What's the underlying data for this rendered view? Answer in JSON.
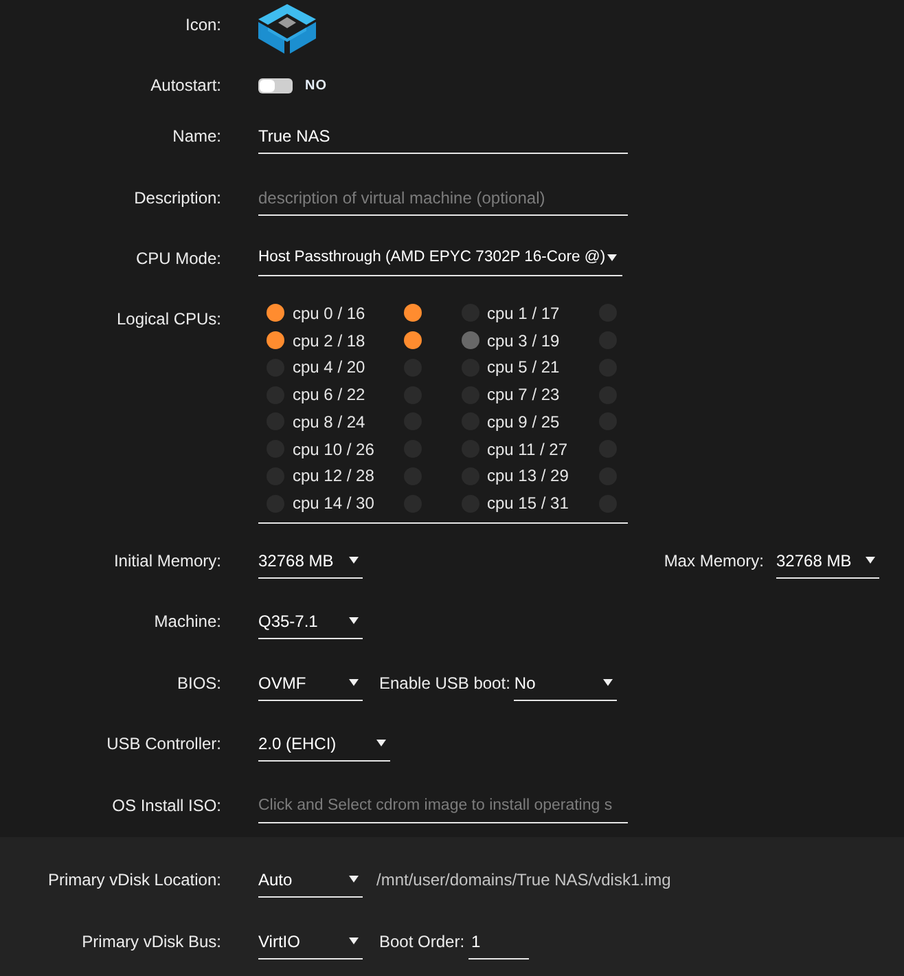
{
  "icon": {
    "label": "Icon:"
  },
  "autostart": {
    "label": "Autostart:",
    "on": false,
    "state_text": "NO"
  },
  "name": {
    "label": "Name:",
    "value": "True NAS"
  },
  "description": {
    "label": "Description:",
    "placeholder": "description of virtual machine (optional)"
  },
  "cpu_mode": {
    "label": "CPU Mode:",
    "value": "Host Passthrough (AMD EPYC 7302P 16-Core @)"
  },
  "logical_cpus": {
    "label": "Logical CPUs:",
    "pairs": [
      {
        "label": "cpu 0 / 16",
        "threads": [
          {
            "checked": true,
            "hovered": false
          },
          {
            "checked": true,
            "hovered": false
          }
        ]
      },
      {
        "label": "cpu 1 / 17",
        "threads": [
          {
            "checked": false,
            "hovered": false
          },
          {
            "checked": false,
            "hovered": false
          }
        ]
      },
      {
        "label": "cpu 2 / 18",
        "threads": [
          {
            "checked": true,
            "hovered": false
          },
          {
            "checked": true,
            "hovered": false
          }
        ]
      },
      {
        "label": "cpu 3 / 19",
        "threads": [
          {
            "checked": false,
            "hovered": true
          },
          {
            "checked": false,
            "hovered": false
          }
        ]
      },
      {
        "label": "cpu 4 / 20",
        "threads": [
          {
            "checked": false,
            "hovered": false
          },
          {
            "checked": false,
            "hovered": false
          }
        ]
      },
      {
        "label": "cpu 5 / 21",
        "threads": [
          {
            "checked": false,
            "hovered": false
          },
          {
            "checked": false,
            "hovered": false
          }
        ]
      },
      {
        "label": "cpu 6 / 22",
        "threads": [
          {
            "checked": false,
            "hovered": false
          },
          {
            "checked": false,
            "hovered": false
          }
        ]
      },
      {
        "label": "cpu 7 / 23",
        "threads": [
          {
            "checked": false,
            "hovered": false
          },
          {
            "checked": false,
            "hovered": false
          }
        ]
      },
      {
        "label": "cpu 8 / 24",
        "threads": [
          {
            "checked": false,
            "hovered": false
          },
          {
            "checked": false,
            "hovered": false
          }
        ]
      },
      {
        "label": "cpu 9 / 25",
        "threads": [
          {
            "checked": false,
            "hovered": false
          },
          {
            "checked": false,
            "hovered": false
          }
        ]
      },
      {
        "label": "cpu 10 / 26",
        "threads": [
          {
            "checked": false,
            "hovered": false
          },
          {
            "checked": false,
            "hovered": false
          }
        ]
      },
      {
        "label": "cpu 11 / 27",
        "threads": [
          {
            "checked": false,
            "hovered": false
          },
          {
            "checked": false,
            "hovered": false
          }
        ]
      },
      {
        "label": "cpu 12 / 28",
        "threads": [
          {
            "checked": false,
            "hovered": false
          },
          {
            "checked": false,
            "hovered": false
          }
        ]
      },
      {
        "label": "cpu 13 / 29",
        "threads": [
          {
            "checked": false,
            "hovered": false
          },
          {
            "checked": false,
            "hovered": false
          }
        ]
      },
      {
        "label": "cpu 14 / 30",
        "threads": [
          {
            "checked": false,
            "hovered": false
          },
          {
            "checked": false,
            "hovered": false
          }
        ]
      },
      {
        "label": "cpu 15 / 31",
        "threads": [
          {
            "checked": false,
            "hovered": false
          },
          {
            "checked": false,
            "hovered": false
          }
        ]
      }
    ]
  },
  "initial_memory": {
    "label": "Initial Memory:",
    "value": "32768 MB"
  },
  "max_memory": {
    "label": "Max Memory:",
    "value": "32768 MB"
  },
  "machine": {
    "label": "Machine:",
    "value": "Q35-7.1"
  },
  "bios": {
    "label": "BIOS:",
    "value": "OVMF"
  },
  "usb_boot": {
    "label": "Enable USB boot:",
    "value": "No"
  },
  "usb_controller": {
    "label": "USB Controller:",
    "value": "2.0 (EHCI)"
  },
  "os_install_iso": {
    "label": "OS Install ISO:",
    "placeholder": "Click and Select cdrom image to install operating s"
  },
  "vdisk": {
    "location": {
      "label": "Primary vDisk Location:",
      "value": "Auto",
      "path": "/mnt/user/domains/True NAS/vdisk1.img"
    },
    "bus": {
      "label": "Primary vDisk Bus:",
      "value": "VirtIO"
    },
    "boot_order": {
      "label": "Boot Order:",
      "value": "1"
    }
  }
}
